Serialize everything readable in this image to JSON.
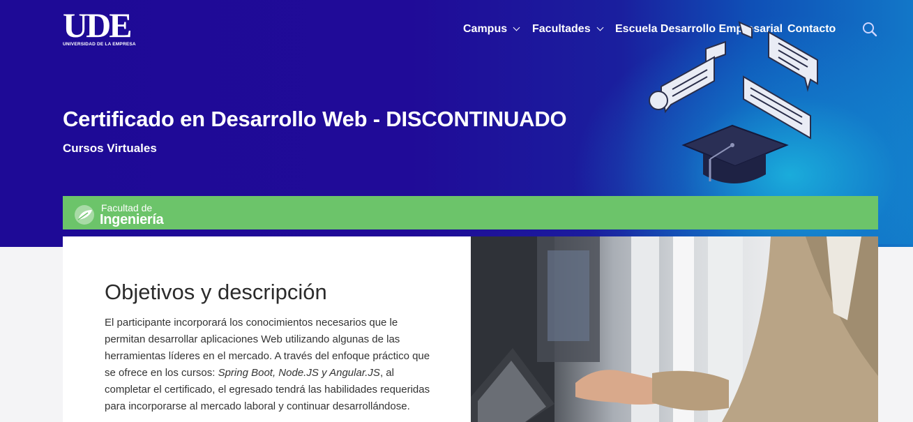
{
  "header": {
    "logo_text": "UDE",
    "logo_subtitle": "UNIVERSIDAD DE LA EMPRESA",
    "nav": [
      {
        "label": "Campus",
        "has_dropdown": true
      },
      {
        "label": "Facultades",
        "has_dropdown": true
      },
      {
        "label": "Escuela Desarrollo Empresarial",
        "has_dropdown": false
      },
      {
        "label": "Contacto",
        "has_dropdown": false
      }
    ],
    "search_icon": "search-icon"
  },
  "hero": {
    "title": "Certificado en Desarrollo Web - DISCONTINUADO",
    "subtitle": "Cursos Virtuales",
    "illustration": "graduation-cap-chat-bubbles-illustration"
  },
  "faculty": {
    "line1": "Facultad de",
    "line2": "Ingeniería",
    "icon": "leaf-icon"
  },
  "content": {
    "heading": "Objetivos y descripción",
    "paragraph_before": "El participante incorporará los conocimientos necesarios que le permitan desarrollar aplicaciones Web utilizando algunas de las herramientas líderes en el mercado. A través del enfoque práctico que se ofrece en los cursos: ",
    "paragraph_italic": "Spring Boot, Node.JS y Angular.JS",
    "paragraph_after": ", al completar el certificado, el egresado tendrá las habilidades requeridas para incorporarse al mercado laboral y continuar desarrollándose."
  },
  "colors": {
    "hero_bg": "#1e0a96",
    "faculty_green": "#6cc46a",
    "text_dark": "#2b2b2b"
  }
}
